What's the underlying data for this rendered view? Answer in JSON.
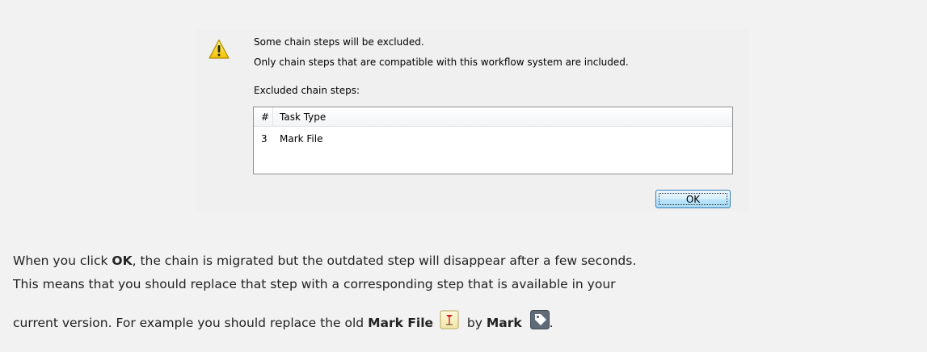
{
  "dialog": {
    "warning_icon": "warning-triangle-icon",
    "message_1": "Some chain steps will be excluded.",
    "message_2": "Only chain steps that are compatible with this workflow system are included.",
    "excluded_label": "Excluded chain steps:",
    "table": {
      "headers": [
        "#",
        "Task Type"
      ],
      "rows": [
        {
          "num": "3",
          "task_type": "Mark File"
        }
      ]
    },
    "ok_label": "OK"
  },
  "paragraph": {
    "l1_a": "When you click ",
    "l1_ok": "OK",
    "l1_b": ", the chain is migrated but the outdated step will disappear after a few seconds.",
    "l2": "This means that you should replace that step with a corresponding step that is available in your",
    "l3_a": "current version. For example you should replace the old ",
    "l3_markfile": "Mark File",
    "l3_by": "by ",
    "l3_mark": "Mark",
    "l3_end": ".",
    "markfile_icon": "mark-file-icon",
    "mark_icon": "tag-icon"
  },
  "colors": {
    "page_bg": "#f2f2f2",
    "dialog_bg": "#f0f0f0",
    "button_border": "#3c7fb1",
    "text": "#222222"
  }
}
